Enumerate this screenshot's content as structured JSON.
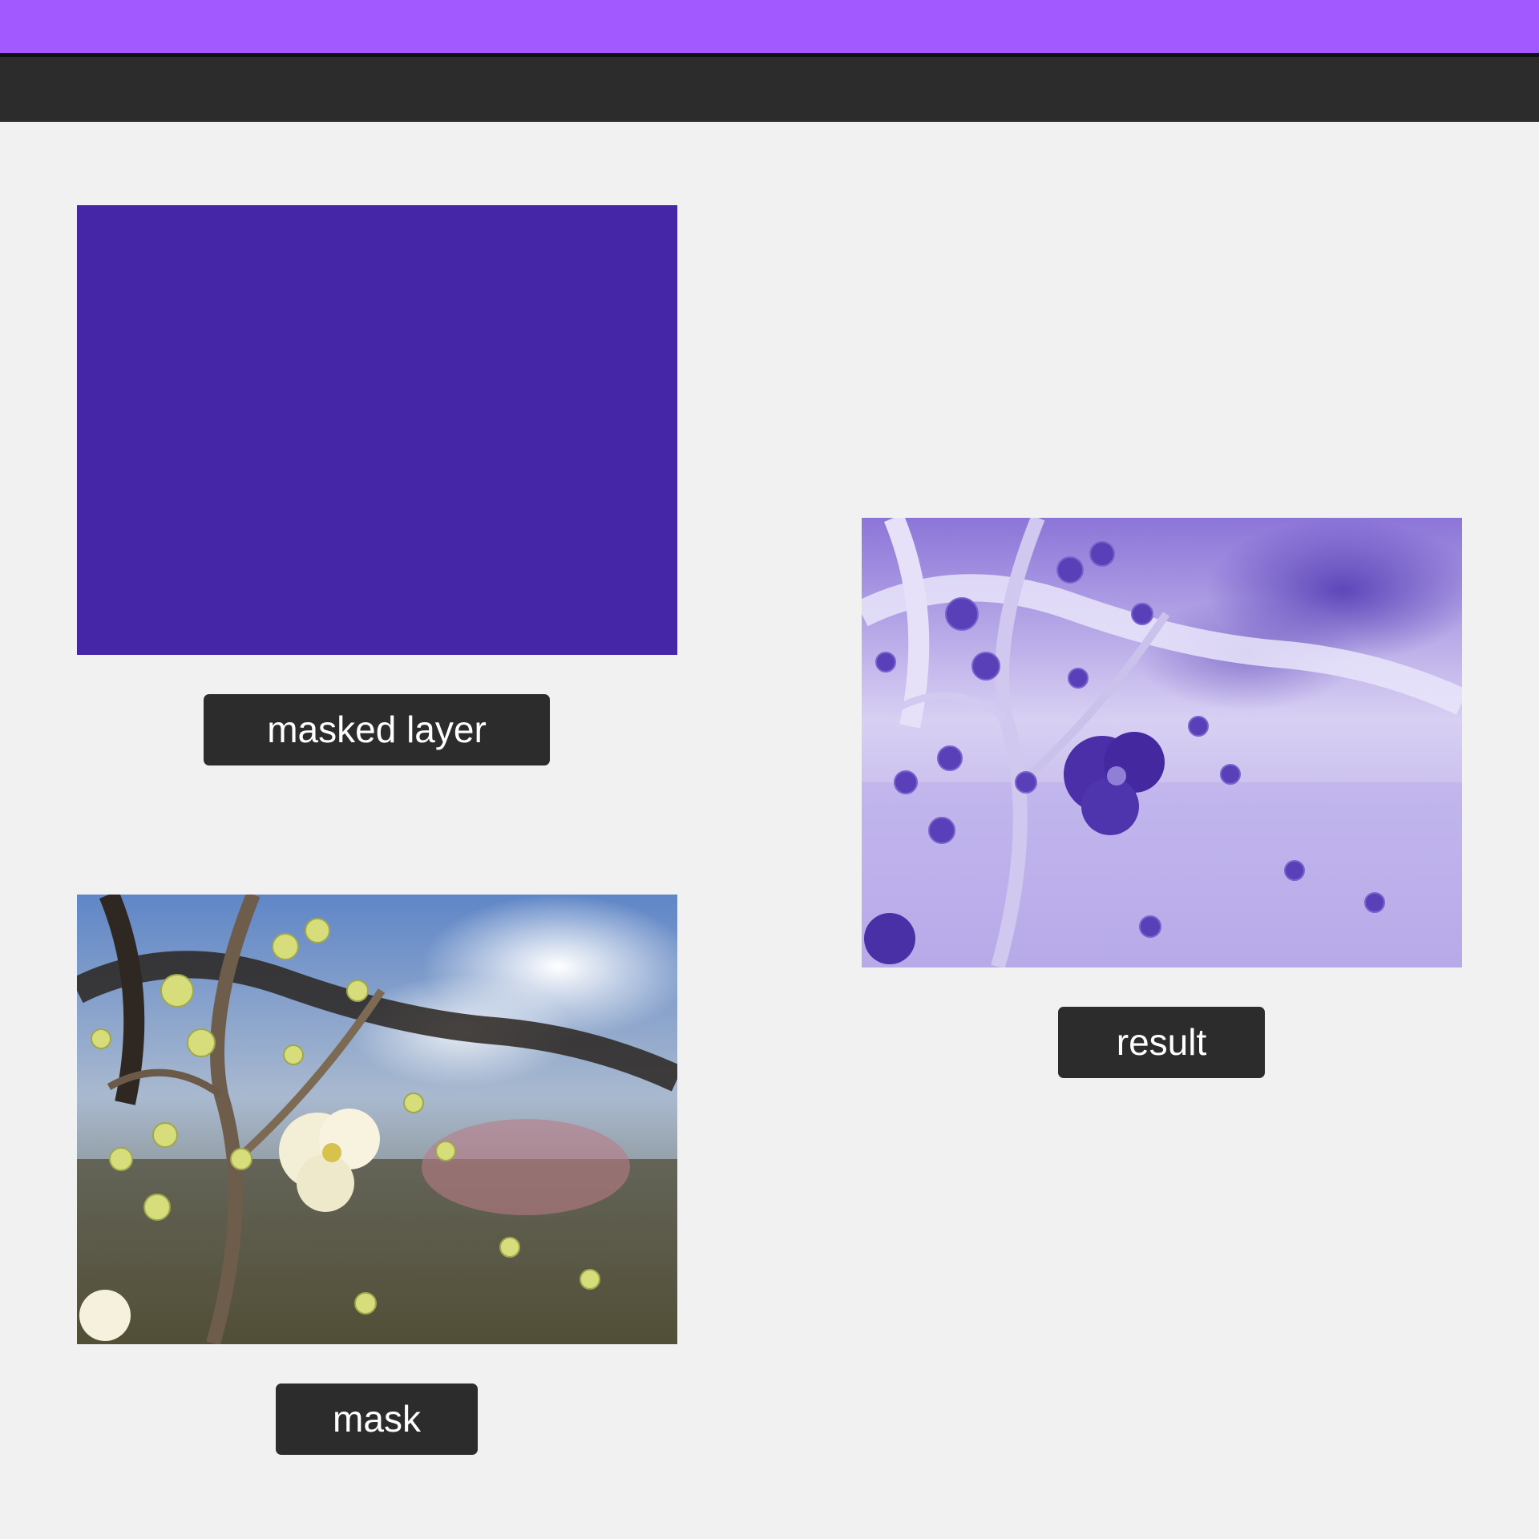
{
  "canvas": {
    "accent_color": "#a259ff",
    "toolbar_color": "#2c2c2c",
    "background_color": "#f1f1f1"
  },
  "frames": {
    "masked_layer": {
      "label": "masked layer",
      "fill_color": "#4526a6"
    },
    "mask": {
      "label": "mask",
      "content": "photo"
    },
    "result": {
      "label": "result",
      "content": "inverted purple-tinted photo"
    }
  }
}
